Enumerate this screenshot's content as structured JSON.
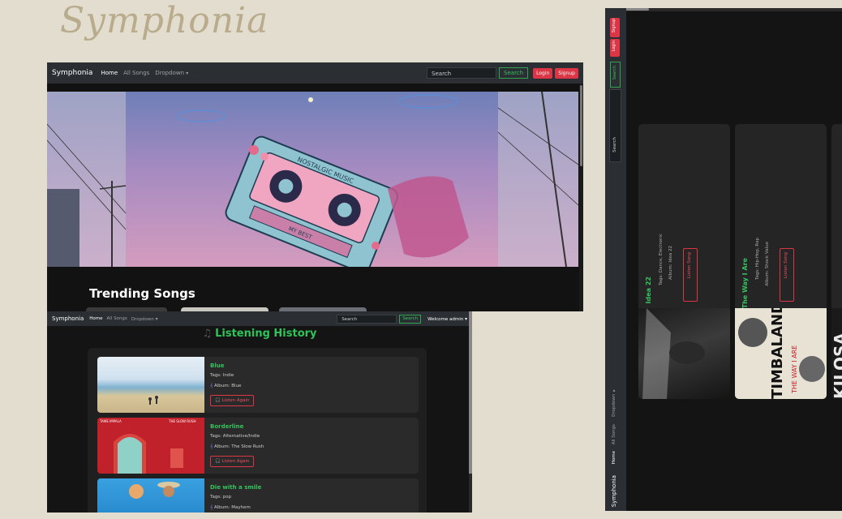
{
  "logo": "Symphonia",
  "home": {
    "nav": {
      "brand": "Symphonia",
      "links": [
        "Home",
        "All Songs",
        "Dropdown"
      ],
      "search_placeholder": "Search",
      "search_button": "Search",
      "login": "Login",
      "signup": "Signup"
    },
    "section_title": "Trending Songs",
    "hero_text": [
      "NOSTALGIC MUSIC",
      "MY BEST"
    ]
  },
  "history": {
    "nav": {
      "brand": "Symphonia",
      "links": [
        "Home",
        "All Songs",
        "Dropdown"
      ],
      "search_placeholder": "Search",
      "search_button": "Search",
      "welcome": "Welcome admin"
    },
    "title": "Listening History",
    "items": [
      {
        "title": "Blue",
        "tags": "Tags: Indie",
        "album": "Album: Blue",
        "button": "Listen Again"
      },
      {
        "title": "Borderline",
        "tags": "Tags: Alternative/Indie",
        "album": "Album: The Slow Rush",
        "button": "Listen Again",
        "cover_text_left": "TAME IMPALA",
        "cover_text_right": "THE SLOW RUSH"
      },
      {
        "title": "Die with a smile",
        "tags": "Tags: pop",
        "album": "Album: Mayhem",
        "button": "Listen Again"
      }
    ]
  },
  "mobile": {
    "nav": {
      "brand": "Symphonia",
      "links": [
        "Home",
        "All Songs",
        "Dropdown"
      ],
      "search_placeholder": "Search",
      "search_button": "Search",
      "login": "Login",
      "signup": "Signup"
    },
    "cards": [
      {
        "title": "Idea 22",
        "tags": "Tags: Dance, Electronic",
        "album": "Album: Idea 22",
        "button": "Listen Song"
      },
      {
        "title": "The Way I Are",
        "tags": "Tags: Hip-Hop, Rap",
        "album": "Album: Shock Value",
        "button": "Listen Song",
        "cover_text": "TIMBALAND",
        "cover_subtext": "THE WAY I ARE"
      },
      {
        "cover_text": "KILOSA"
      }
    ]
  },
  "colors": {
    "accent_green": "#2ec45a",
    "danger_red": "#dc3545",
    "navbar": "#2b2f33",
    "background": "#e3ddd0"
  }
}
